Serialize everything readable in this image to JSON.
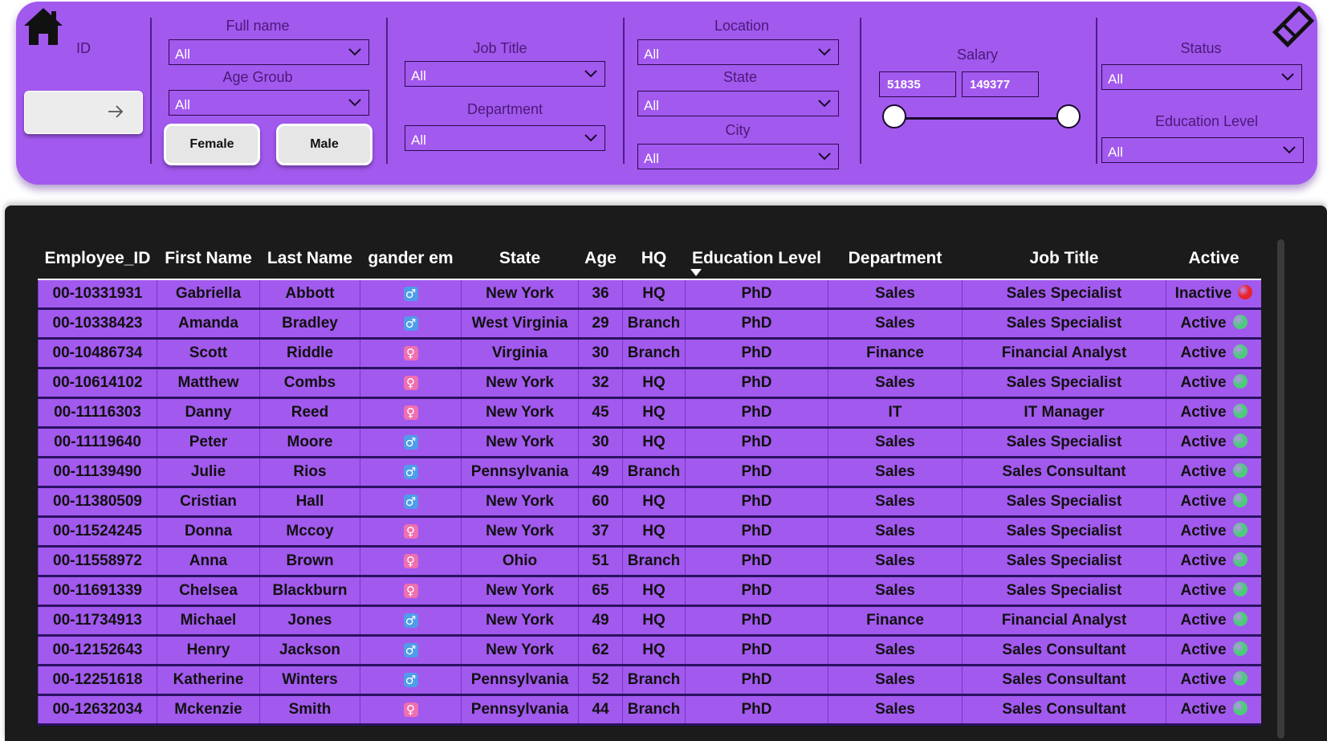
{
  "filters": {
    "id_label": "ID",
    "full_name": {
      "label": "Full name",
      "value": "All"
    },
    "age_group": {
      "label": "Age Groub",
      "value": "All"
    },
    "job_title": {
      "label": "Job Title",
      "value": "All"
    },
    "department": {
      "label": "Department",
      "value": "All"
    },
    "location": {
      "label": "Location",
      "value": "All"
    },
    "state": {
      "label": "State",
      "value": "All"
    },
    "city": {
      "label": "City",
      "value": "All"
    },
    "salary": {
      "label": "Salary",
      "min": "51835",
      "max": "149377"
    },
    "status": {
      "label": "Status",
      "value": "All"
    },
    "education_level": {
      "label": "Education Level",
      "value": "All"
    },
    "gender_buttons": {
      "female": "Female",
      "male": "Male"
    }
  },
  "icons": {
    "home": "home-icon",
    "clear": "diamond-eraser-icon",
    "go": "arrow-right-icon",
    "male": "♂",
    "female": "♀"
  },
  "colors": {
    "panel": "#a259ee",
    "table_bg": "#1b1b1b",
    "active_dot": "#4ccc7a",
    "inactive_dot": "#e8242c"
  },
  "table": {
    "columns": [
      "Employee_ID",
      "First Name",
      "Last Name",
      "gander em",
      "State",
      "Age",
      "HQ",
      "Education Level",
      "Department",
      "Job Title",
      "Active"
    ],
    "rows": [
      {
        "id": "00-10331931",
        "first": "Gabriella",
        "last": "Abbott",
        "gender": "male",
        "state": "New York",
        "age": "36",
        "hq": "HQ",
        "edu": "PhD",
        "dept": "Sales",
        "job": "Sales Specialist",
        "status": "Inactive"
      },
      {
        "id": "00-10338423",
        "first": "Amanda",
        "last": "Bradley",
        "gender": "male",
        "state": "West Virginia",
        "age": "29",
        "hq": "Branch",
        "edu": "PhD",
        "dept": "Sales",
        "job": "Sales Specialist",
        "status": "Active"
      },
      {
        "id": "00-10486734",
        "first": "Scott",
        "last": "Riddle",
        "gender": "female",
        "state": "Virginia",
        "age": "30",
        "hq": "Branch",
        "edu": "PhD",
        "dept": "Finance",
        "job": "Financial Analyst",
        "status": "Active"
      },
      {
        "id": "00-10614102",
        "first": "Matthew",
        "last": "Combs",
        "gender": "female",
        "state": "New York",
        "age": "32",
        "hq": "HQ",
        "edu": "PhD",
        "dept": "Sales",
        "job": "Sales Specialist",
        "status": "Active"
      },
      {
        "id": "00-11116303",
        "first": "Danny",
        "last": "Reed",
        "gender": "female",
        "state": "New York",
        "age": "45",
        "hq": "HQ",
        "edu": "PhD",
        "dept": "IT",
        "job": "IT Manager",
        "status": "Active"
      },
      {
        "id": "00-11119640",
        "first": "Peter",
        "last": "Moore",
        "gender": "male",
        "state": "New York",
        "age": "30",
        "hq": "HQ",
        "edu": "PhD",
        "dept": "Sales",
        "job": "Sales Specialist",
        "status": "Active"
      },
      {
        "id": "00-11139490",
        "first": "Julie",
        "last": "Rios",
        "gender": "male",
        "state": "Pennsylvania",
        "age": "49",
        "hq": "Branch",
        "edu": "PhD",
        "dept": "Sales",
        "job": "Sales Consultant",
        "status": "Active"
      },
      {
        "id": "00-11380509",
        "first": "Cristian",
        "last": "Hall",
        "gender": "male",
        "state": "New York",
        "age": "60",
        "hq": "HQ",
        "edu": "PhD",
        "dept": "Sales",
        "job": "Sales Specialist",
        "status": "Active"
      },
      {
        "id": "00-11524245",
        "first": "Donna",
        "last": "Mccoy",
        "gender": "female",
        "state": "New York",
        "age": "37",
        "hq": "HQ",
        "edu": "PhD",
        "dept": "Sales",
        "job": "Sales Specialist",
        "status": "Active"
      },
      {
        "id": "00-11558972",
        "first": "Anna",
        "last": "Brown",
        "gender": "female",
        "state": "Ohio",
        "age": "51",
        "hq": "Branch",
        "edu": "PhD",
        "dept": "Sales",
        "job": "Sales Specialist",
        "status": "Active"
      },
      {
        "id": "00-11691339",
        "first": "Chelsea",
        "last": "Blackburn",
        "gender": "female",
        "state": "New York",
        "age": "65",
        "hq": "HQ",
        "edu": "PhD",
        "dept": "Sales",
        "job": "Sales Specialist",
        "status": "Active"
      },
      {
        "id": "00-11734913",
        "first": "Michael",
        "last": "Jones",
        "gender": "male",
        "state": "New York",
        "age": "49",
        "hq": "HQ",
        "edu": "PhD",
        "dept": "Finance",
        "job": "Financial Analyst",
        "status": "Active"
      },
      {
        "id": "00-12152643",
        "first": "Henry",
        "last": "Jackson",
        "gender": "male",
        "state": "New York",
        "age": "62",
        "hq": "HQ",
        "edu": "PhD",
        "dept": "Sales",
        "job": "Sales Consultant",
        "status": "Active"
      },
      {
        "id": "00-12251618",
        "first": "Katherine",
        "last": "Winters",
        "gender": "male",
        "state": "Pennsylvania",
        "age": "52",
        "hq": "Branch",
        "edu": "PhD",
        "dept": "Sales",
        "job": "Sales Consultant",
        "status": "Active"
      },
      {
        "id": "00-12632034",
        "first": "Mckenzie",
        "last": "Smith",
        "gender": "female",
        "state": "Pennsylvania",
        "age": "44",
        "hq": "Branch",
        "edu": "PhD",
        "dept": "Sales",
        "job": "Sales Consultant",
        "status": "Active"
      }
    ]
  }
}
